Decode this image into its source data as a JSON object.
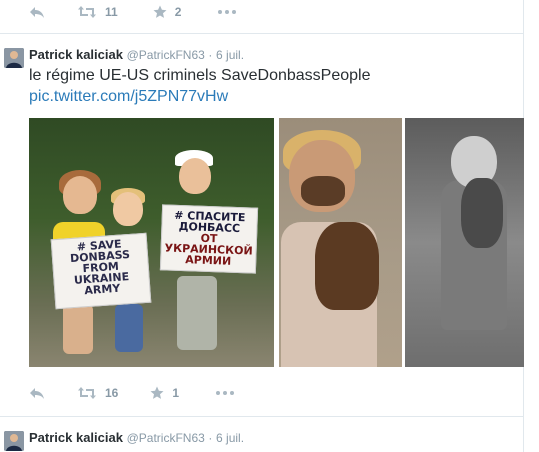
{
  "top_actions": {
    "retweet_count": "11",
    "favorite_count": "2"
  },
  "tweets": [
    {
      "fullname": "Patrick kaliciak",
      "handle": "@PatrickFN63",
      "separator": "·",
      "time": "6 juil.",
      "text": "le régime UE-US criminels SaveDonbassPeople",
      "link": "pic.twitter.com/j5ZPN77vHw",
      "media": {
        "sign1_lines": [
          "# SAVE",
          "DONBASS",
          "FROM",
          "UKRAINE",
          "ARMY"
        ],
        "sign2_lines": [
          "# СПАСИТЕ",
          "ДОНБАСС",
          "ОТ",
          "УКРАИНСКОЙ",
          "АРМИИ"
        ]
      },
      "actions": {
        "retweet_count": "16",
        "favorite_count": "1"
      }
    },
    {
      "fullname": "Patrick kaliciak",
      "handle": "@PatrickFN63",
      "separator": "·",
      "time": "6 juil."
    }
  ],
  "icons": [
    "reply-icon",
    "retweet-icon",
    "favorite-icon",
    "more-icon"
  ],
  "colors": {
    "text": "#292f33",
    "muted": "#8899a6",
    "link": "#2b7bb9",
    "border": "#e1e8ed"
  }
}
